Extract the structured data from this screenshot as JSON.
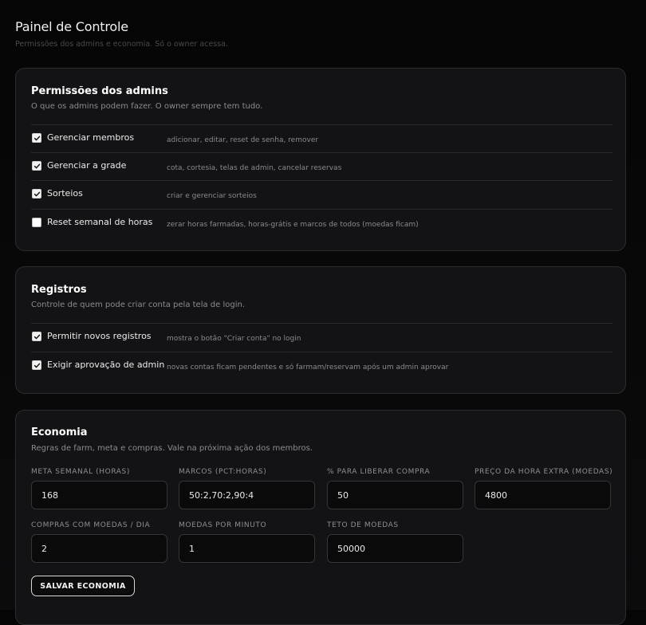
{
  "header": {
    "title": "Painel de Controle",
    "subtitle": "Permissões dos admins e economia. Só o owner acessa."
  },
  "permissions": {
    "title": "Permissões dos admins",
    "description": "O que os admins podem fazer. O owner sempre tem tudo.",
    "items": [
      {
        "label": "Gerenciar membros",
        "hint": "adicionar, editar, reset de senha, remover",
        "checked": true
      },
      {
        "label": "Gerenciar a grade",
        "hint": "cota, cortesia, telas de admin, cancelar reservas",
        "checked": true
      },
      {
        "label": "Sorteios",
        "hint": "criar e gerenciar sorteios",
        "checked": true
      },
      {
        "label": "Reset semanal de horas",
        "hint": "zerar horas farmadas, horas-grátis e marcos de todos (moedas ficam)",
        "checked": false
      }
    ]
  },
  "registrations": {
    "title": "Registros",
    "description": "Controle de quem pode criar conta pela tela de login.",
    "items": [
      {
        "label": "Permitir novos registros",
        "hint": "mostra o botão \"Criar conta\" no login",
        "checked": true
      },
      {
        "label": "Exigir aprovação de admin",
        "hint": "novas contas ficam pendentes e só farmam/reservam após um admin aprovar",
        "checked": true
      }
    ]
  },
  "economy": {
    "title": "Economia",
    "description": "Regras de farm, meta e compras. Vale na próxima ação dos membros.",
    "fields": [
      {
        "label": "META SEMANAL (HORAS)",
        "value": "168"
      },
      {
        "label": "MARCOS (PCT:HORAS)",
        "value": "50:2,70:2,90:4"
      },
      {
        "label": "% PARA LIBERAR COMPRA",
        "value": "50"
      },
      {
        "label": "PREÇO DA HORA EXTRA (MOEDAS)",
        "value": "4800"
      },
      {
        "label": "COMPRAS COM MOEDAS / DIA",
        "value": "2"
      },
      {
        "label": "MOEDAS POR MINUTO",
        "value": "1"
      },
      {
        "label": "TETO DE MOEDAS",
        "value": "50000"
      }
    ],
    "save_label": "SALVAR ECONOMIA"
  }
}
